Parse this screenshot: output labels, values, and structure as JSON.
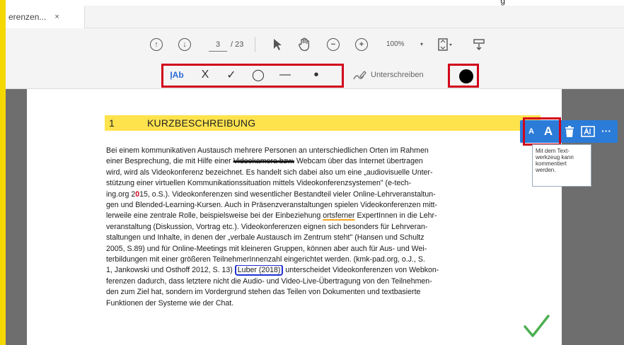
{
  "top_cut_text": "g",
  "tab": {
    "title": "erenzen...",
    "close_label": "×"
  },
  "toolbar": {
    "page_current": "3",
    "page_total": "/ 23",
    "zoom": "100%",
    "zoom_arrow": "▾"
  },
  "annot_tools": {
    "text_tool": "ĮAb",
    "cross": "X",
    "check": "✓",
    "ellipse": "◯",
    "line": "—",
    "dot": "•",
    "sign_label": "Unterschreiben"
  },
  "text_popup": {
    "small_a": "A",
    "large_a": "A",
    "more": "···",
    "comment_lines": [
      "Mit dem Text-",
      "werkzeug kann",
      "kommentiert",
      "werden."
    ]
  },
  "document": {
    "heading_number": "1",
    "heading_text": "KURZBESCHREIBUNG",
    "lines": [
      {
        "pre": "Bei einem kommunikativen Austausch mehrere Personen an unterschiedlichen Orten im Rahmen"
      },
      {
        "pre": "einer Besprechung, die mit Hilfe einer ",
        "strike": "Videokamera bzw.",
        "post": " Webcam über das Internet übertragen"
      },
      {
        "pre": "wird, wird als Videokonferenz bezeichnet. Es handelt sich dabei also um eine „audiovisuelle Unter-"
      },
      {
        "pre": "stützung einer virtuellen Kommunikationssituation mittels Videokonferenzsystemen\" (e-tech-"
      },
      {
        "pre": "ing.org 2",
        "redx": "0",
        "post": "15, o.S.). Videokonferenzen sind wesentlicher Bestandteil vieler Online-Lehrveranstaltun-"
      },
      {
        "pre": "gen und Blended-Learning-Kursen. Auch in Präsenzveranstaltungen spielen Videokonferenzen mitt-"
      },
      {
        "pre": "lerweile eine zentrale Rolle, beispielsweise bei der Einbeziehung ",
        "underline": "ortsferner",
        "post": " ExpertInnen in die Lehr-"
      },
      {
        "pre": "veranstaltung (Diskussion, Vortrag etc.). Videokonferenzen eignen sich besonders für Lehrveran-"
      },
      {
        "pre": "staltungen und Inhalte, in denen der „verbale Austausch im Zentrum steht\" (Hansen und Schultz"
      },
      {
        "pre": "2005, S.89) und für Online-Meetings mit kleineren Gruppen, können aber auch für Aus- und Wei-"
      },
      {
        "pre": "terbildungen mit einer größeren TeilnehmerInnenzahl eingerichtet werden. (kmk-pad.org, o.J., S."
      },
      {
        "pre": "1, Jankowski und Osthoff 2012, S. 13) ",
        "boxed": "Luber (2018)",
        "post": " unterscheidet Videokonferenzen von Webkon-"
      },
      {
        "pre": "ferenzen dadurch, dass letztere nicht die Audio- und Video-Live-Übertragung von den Teilnehmen-"
      },
      {
        "pre": "den zum Ziel hat, sondern im Vordergrund stehen das Teilen von Dokumenten und textbasierte"
      },
      {
        "pre": "Funktionen der Systeme wie der Chat."
      }
    ]
  },
  "colors": {
    "highlight_frame": "#d0021b",
    "heading_highlight": "#ffe34d",
    "popup_blue": "#2b7bd8",
    "check_green": "#4caf50",
    "left_bar": "#f5d800"
  }
}
